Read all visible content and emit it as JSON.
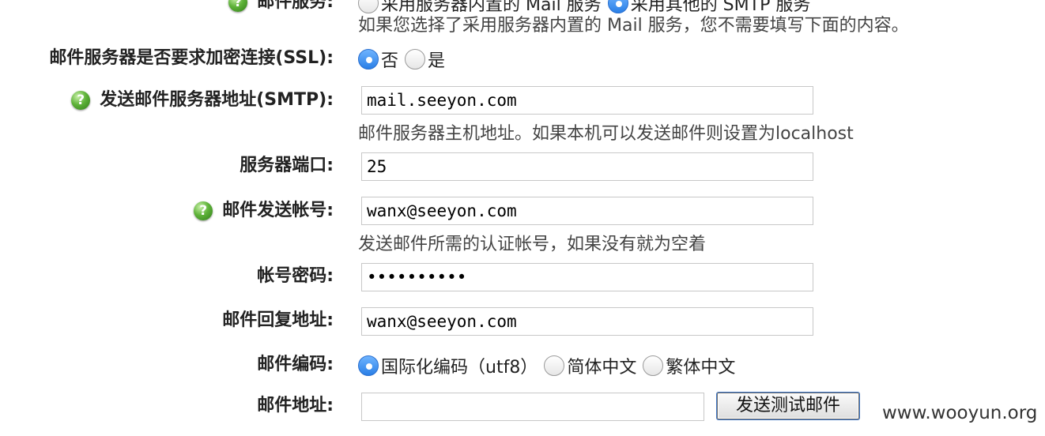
{
  "mail_type": {
    "label": "邮件服务:",
    "option_builtin": "采用服务器内置的 Mail 服务",
    "option_smtp": "采用其他的 SMTP 服务",
    "hint": "如果您选择了采用服务器内置的 Mail 服务，您不需要填写下面的内容。"
  },
  "ssl": {
    "label": "邮件服务器是否要求加密连接(SSL):",
    "option_no": "否",
    "option_yes": "是",
    "selected": "否"
  },
  "smtp": {
    "label": "发送邮件服务器地址(SMTP):",
    "value": "mail.seeyon.com",
    "hint": "邮件服务器主机地址。如果本机可以发送邮件则设置为localhost"
  },
  "port": {
    "label": "服务器端口:",
    "value": "25"
  },
  "account": {
    "label": "邮件发送帐号:",
    "value": "wanx@seeyon.com",
    "hint": "发送邮件所需的认证帐号，如果没有就为空着"
  },
  "password": {
    "label": "帐号密码:",
    "value": "••••••••••"
  },
  "reply": {
    "label": "邮件回复地址:",
    "value": "wanx@seeyon.com"
  },
  "encoding": {
    "label": "邮件编码:",
    "options": [
      "国际化编码（utf8）",
      "简体中文",
      "繁体中文"
    ],
    "selected": "国际化编码（utf8）"
  },
  "test": {
    "label": "邮件地址:",
    "value": "",
    "button": "发送测试邮件"
  },
  "help_icon_glyph": "?",
  "watermark": "www.wooyun.org",
  "colors": {
    "radio_selected": "#2a7fe6",
    "help_icon": "#5fb33a",
    "button_focus": "#3f76c4"
  }
}
